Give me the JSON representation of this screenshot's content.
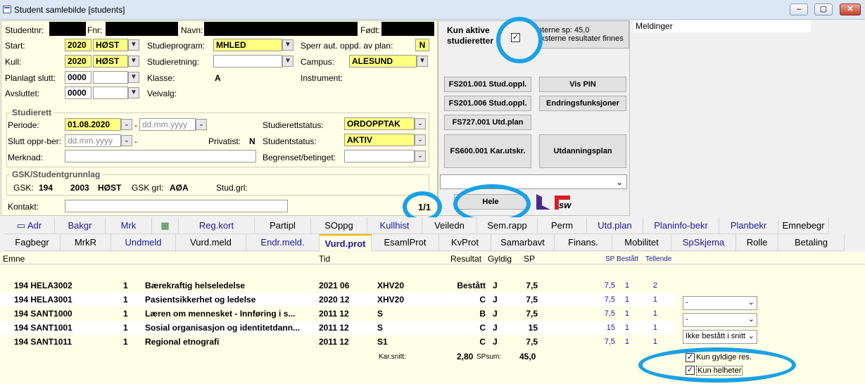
{
  "window": {
    "title": "Student samlebilde  [students]",
    "min": "–",
    "max": "▢",
    "close": "✕"
  },
  "student": {
    "studentnr_label": "Studentnr:",
    "fnr_label": "Fnr:",
    "navn_label": "Navn:",
    "fodt_label": "Født:",
    "start_label": "Start:",
    "start_year": "2020",
    "start_term": "HØST",
    "kull_label": "Kull:",
    "kull_year": "2020",
    "kull_term": "HØST",
    "planlagt_label": "Planlagt slutt:",
    "planlagt_value": "0000",
    "avsluttet_label": "Avsluttet:",
    "avsluttet_value": "0000",
    "studieprogram_label": "Studieprogram:",
    "studieprogram_value": "MHLED",
    "studieretning_label": "Studieretning:",
    "klasse_label": "Klasse:",
    "klasse_value": "A",
    "veivalg_label": "Veivalg:",
    "sperr_label": "Sperr aut. oppd. av plan:",
    "sperr_value": "N",
    "campus_label": "Campus:",
    "campus_value": "ALESUND",
    "instrument_label": "Instrument:"
  },
  "studierett": {
    "title": "Studierett",
    "periode_label": "Periode:",
    "periode_value": "01.08.2020",
    "periode_to": "dd.mm.yyyy",
    "dash": "-",
    "slutt_label": "Slutt oppr-ber:",
    "slutt_value": "dd.mm.yyyy",
    "privatist_label": "Privatist:",
    "privatist_value": "N",
    "merknad_label": "Merknad:",
    "studierettstatus_label": "Studierettstatus:",
    "studierettstatus_value": "ORDOPPTAK",
    "studentstatus_label": "Studentstatus:",
    "studentstatus_value": "AKTIV",
    "begrenset_label": "Begrenset/betinget:"
  },
  "gsk": {
    "title": "GSK/Studentgrunnlag",
    "gsk_label": "GSK:",
    "gsk_value": "194",
    "gsk_year": "2003",
    "gsk_term": "HØST",
    "grl_label": "GSK grl:",
    "grl_value": "AØA",
    "studgrl_label": "Stud.grl:"
  },
  "kontakt_label": "Kontakt:",
  "mid": {
    "kun_aktive": "Kun aktive studieretter",
    "sp_line1": "Interne sp: 45,0",
    "sp_line2": "Eksterne resultater finnes",
    "buttons": [
      "FS201.001 Stud.oppl.",
      "Vis PIN",
      "FS201.006 Stud.oppl.",
      "Endringsfunksjoner",
      "FS727.001 Utd.plan",
      "FS600.001 Kar.utskr.",
      "Utdanningsplan"
    ],
    "counter": "1/1",
    "hele": "Hele",
    "logo_text": "sw"
  },
  "meldinger": "Meldinger",
  "tabs_row1": [
    {
      "label": "Adr",
      "blue": true
    },
    {
      "label": "Bakgr",
      "blue": true
    },
    {
      "label": "Mrk",
      "blue": true
    },
    {
      "label": "",
      "blue": false
    },
    {
      "label": "Reg.kort",
      "blue": true
    },
    {
      "label": "Partipl",
      "blue": false
    },
    {
      "label": "SOppg",
      "blue": false
    },
    {
      "label": "Kullhist",
      "blue": true
    },
    {
      "label": "Veiledn",
      "blue": false
    },
    {
      "label": "Sem.rapp",
      "blue": false
    },
    {
      "label": "Perm",
      "blue": false
    },
    {
      "label": "Utd.plan",
      "blue": true
    },
    {
      "label": "Planinfo-bekr",
      "blue": true
    },
    {
      "label": "Planbekr",
      "blue": true
    },
    {
      "label": "Emnebegr",
      "blue": false
    }
  ],
  "tabs_row2": [
    {
      "label": "Fagbegr",
      "blue": false
    },
    {
      "label": "MrkR",
      "blue": false
    },
    {
      "label": "Undmeld",
      "blue": true
    },
    {
      "label": "Vurd.meld",
      "blue": false
    },
    {
      "label": "Endr.meld.",
      "blue": true
    },
    {
      "label": "Vurd.prot",
      "blue": true,
      "active": true
    },
    {
      "label": "EsamlProt",
      "blue": false
    },
    {
      "label": "KvProt",
      "blue": false
    },
    {
      "label": "Samarbavt",
      "blue": false
    },
    {
      "label": "Finans.",
      "blue": false
    },
    {
      "label": "Mobilitet",
      "blue": false
    },
    {
      "label": "SpSkjema",
      "blue": true
    },
    {
      "label": "Rolle",
      "blue": false
    },
    {
      "label": "Betaling",
      "blue": false
    }
  ],
  "table": {
    "headers": {
      "emne": "Emne",
      "tid": "Tid",
      "resultat": "Resultat",
      "gyldig": "Gyldig",
      "sp": "SP",
      "sp2": "SP",
      "bestatt": "Bestått",
      "tellende": "Tellende"
    },
    "rows": [
      {
        "emne": "194 HELA3002",
        "ver": "1",
        "navn": "Bærekraftig helseledelse",
        "tid": "2021 06",
        "kode": "XHV20",
        "res": "Bestått",
        "gyldig": "J",
        "sp": "7,5",
        "sp2": "7,5",
        "best": "1",
        "tell": "2"
      },
      {
        "emne": "194 HELA3001",
        "ver": "1",
        "navn": "Pasientsikkerhet og ledelse",
        "tid": "2020 12",
        "kode": "XHV20",
        "res": "C",
        "gyldig": "J",
        "sp": "7,5",
        "sp2": "7,5",
        "best": "1",
        "tell": "1"
      },
      {
        "emne": "194 SANT1000",
        "ver": "1",
        "navn": "Læren om mennesket - Innføring i s...",
        "tid": "2011 12",
        "kode": "S",
        "res": "B",
        "gyldig": "J",
        "sp": "7,5",
        "sp2": "7,5",
        "best": "1",
        "tell": "1"
      },
      {
        "emne": "194 SANT1001",
        "ver": "1",
        "navn": "Sosial organisasjon og identitetdann...",
        "tid": "2011 12",
        "kode": "S",
        "res": "C",
        "gyldig": "J",
        "sp": "15",
        "sp2": "15",
        "best": "1",
        "tell": "1"
      },
      {
        "emne": "194 SANT1011",
        "ver": "1",
        "navn": "Regional etnografi",
        "tid": "2011 12",
        "kode": "S1",
        "res": "C",
        "gyldig": "J",
        "sp": "7,5",
        "sp2": "7,5",
        "best": "1",
        "tell": "1"
      }
    ],
    "karsnitt_label": "Kar.snitt:",
    "karsnitt_value": "2,80",
    "spsum_label": "SPsum:",
    "spsum_value": "45,0"
  },
  "filters": {
    "combo1": "-",
    "combo2": "-",
    "combo3": "Ikke bestått i snitt",
    "kun_gyldige": "Kun gyldige res.",
    "kun_helheter": "Kun helheter"
  },
  "colors": {
    "ring": "#1aa1e6",
    "yellow_field": "#ffff80",
    "panel_bg": "#fffee6",
    "tab_blue": "#1a1aa0"
  }
}
